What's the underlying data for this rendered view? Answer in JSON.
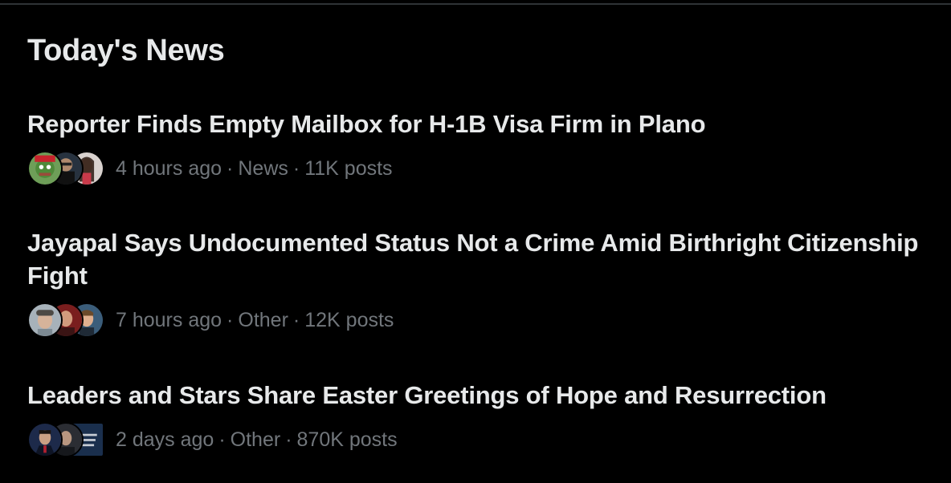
{
  "section": {
    "title": "Today's News"
  },
  "items": [
    {
      "headline": "Reporter Finds Empty Mailbox for H-1B Visa Firm in Plano",
      "time": "4 hours ago",
      "category": "News",
      "posts": "11K posts"
    },
    {
      "headline": "Jayapal Says Undocumented Status Not a Crime Amid Birthright Citizenship Fight",
      "time": "7 hours ago",
      "category": "Other",
      "posts": "12K posts"
    },
    {
      "headline": "Leaders and Stars Share Easter Greetings of Hope and Resurrection",
      "time": "2 days ago",
      "category": "Other",
      "posts": "870K posts"
    }
  ],
  "separator": "·",
  "colors": {
    "background": "#000000",
    "headline": "#e7e9ea",
    "meta": "#71767b",
    "border": "#2f3336"
  }
}
